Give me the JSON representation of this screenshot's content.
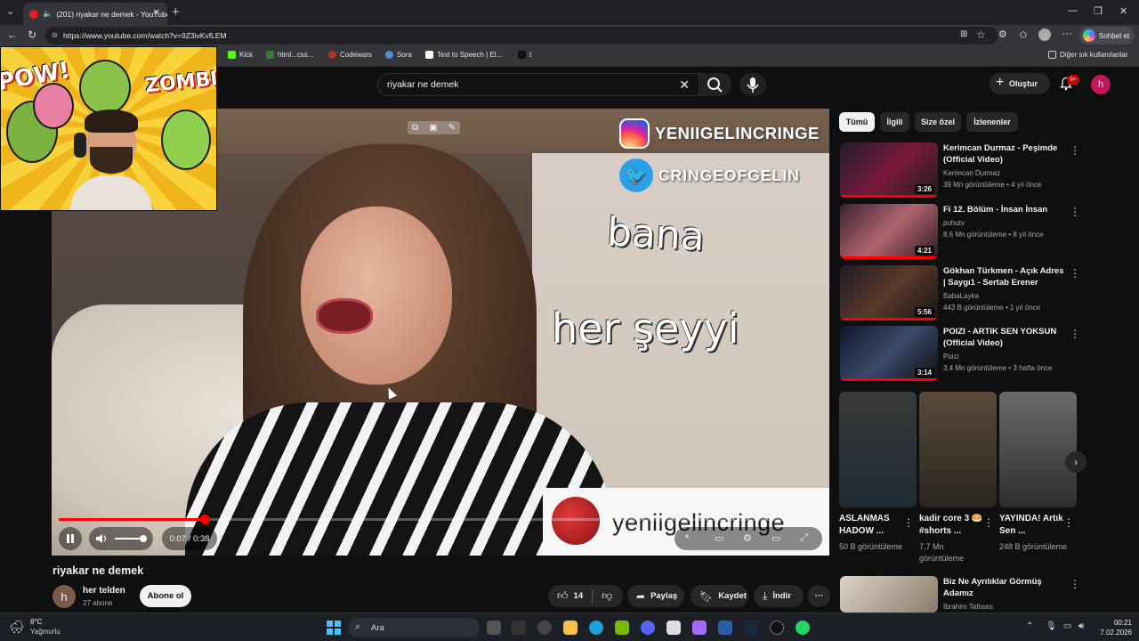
{
  "browser": {
    "tab_title": "(201) riyakar ne demek - YouTube",
    "url": "https://www.youtube.com/watch?v=9Z3ivKvfLEM",
    "chat_button": "Sohbet et",
    "bookmarks": [
      "Kick",
      "html...css...",
      "Codewars",
      "Sora",
      "Text to Speech | El...",
      "t"
    ],
    "other_bookmarks": "Diğer sık kullanılanlar"
  },
  "youtube": {
    "search_query": "riyakar ne demek",
    "create_label": "Oluştur",
    "notif_badge": "9+",
    "avatar_letter": "h"
  },
  "video": {
    "overlay_instagram": "YENIIGELINCRINGE",
    "overlay_twitter": "CRINGEOFGELIN",
    "caption_line1": "bana",
    "caption_line2": "her şeyyi",
    "watermark": "yeniigelincringe",
    "current_time": "0:07",
    "duration": "0:38",
    "time_display": "0:07 / 0:38",
    "progress_fraction": 0.19
  },
  "webcam": {
    "pow_text": "POW!",
    "zombie_text": "ZOMBIE!"
  },
  "meta": {
    "title": "riyakar ne demek",
    "channel_name": "her telden",
    "channel_avatar": "h",
    "subscribers": "27 abone",
    "subscribe_label": "Abone ol",
    "likes": "14",
    "share_label": "Paylaş",
    "save_label": "Kaydet",
    "download_label": "İndir"
  },
  "sidebar": {
    "chips": [
      "Tümü",
      "İlgili",
      "Size özel",
      "İzlenenler"
    ],
    "recommendations": [
      {
        "title": "Kerimcan Durmaz - Peşimde (Official Video)",
        "channel": "Kerimcan Durmaz",
        "stats": "39 Mn görüntüleme • 4 yıl önce",
        "duration": "3:26"
      },
      {
        "title": "Fi 12. Bölüm - İnsan İnsan",
        "channel": "puhutv",
        "stats": "8,6 Mn görüntüleme • 8 yıl önce",
        "duration": "4:21"
      },
      {
        "title": "Gökhan Türkmen - Açık Adres | Saygı1 - Sertab Erener",
        "channel": "BabaLayka",
        "stats": "443 B görüntüleme • 1 yıl önce",
        "duration": "5:56"
      },
      {
        "title": "POIZI - ARTIK SEN YOKSUN (Official Video)",
        "channel": "Poizi",
        "stats": "3,4 Mn görüntüleme • 3 hafta önce",
        "duration": "3:14"
      }
    ],
    "shorts": [
      {
        "title": "ASLANMAS HADOW ...",
        "views": "50 B görüntüleme"
      },
      {
        "title": "kadir core 3 🥯#shorts ...",
        "views": "7,7 Mn görüntüleme"
      },
      {
        "title": "YAYINDA! Artık Sen ...",
        "views": "248 B görüntüleme"
      }
    ],
    "bottom_rec": {
      "title": "Biz Ne Ayrılıklar Görmüş Adamız",
      "channel": "İbrahim Tatlıses"
    }
  },
  "taskbar": {
    "temperature": "8°C",
    "weather": "Yağmurlu",
    "search_label": "Ara",
    "time": "00:21",
    "date": "7.02.2026"
  },
  "colors": {
    "accent_red": "#ff0000",
    "background": "#0f0f0f"
  }
}
